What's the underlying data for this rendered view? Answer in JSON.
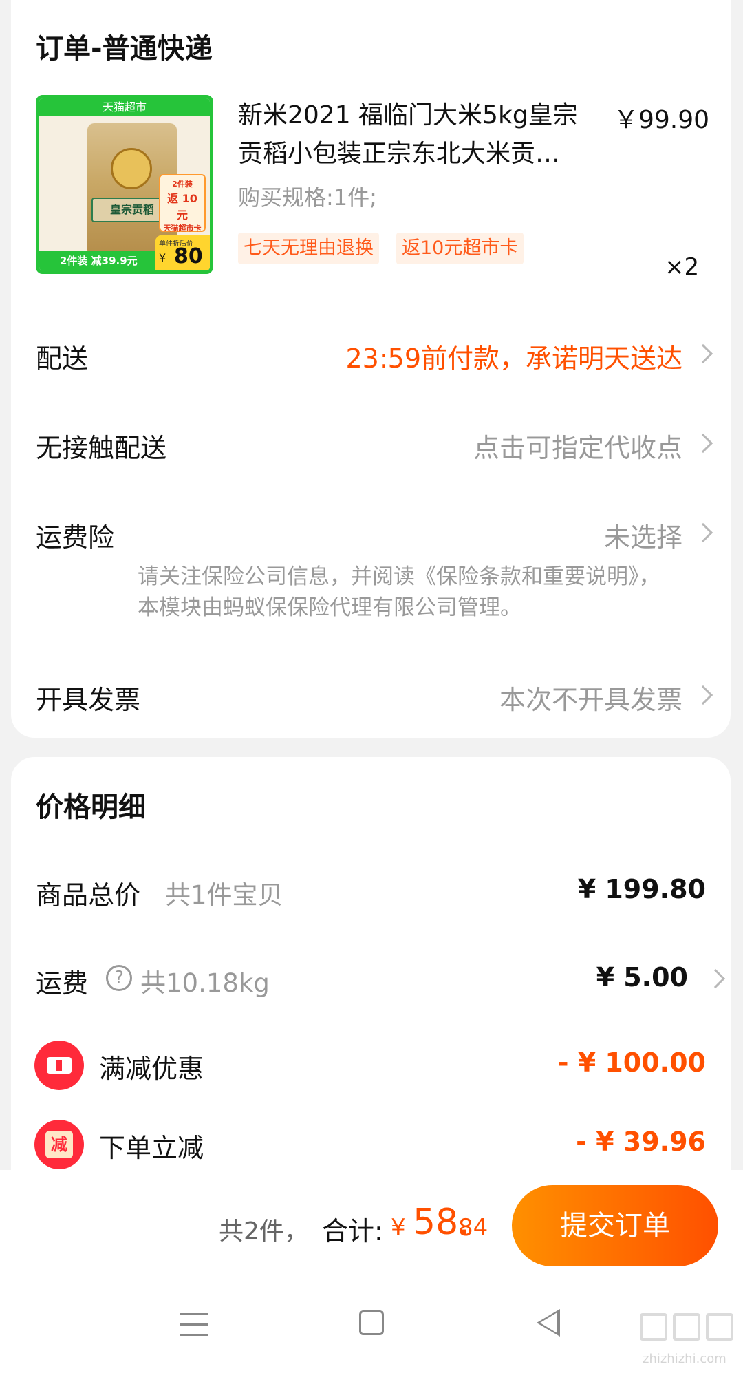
{
  "order": {
    "title": "订单-普通快递",
    "product": {
      "title_line1": "新米2021 福临门大米5kg皇宗",
      "title_line2": "贡稻小包装正宗东北大米贡…",
      "price": "￥99.90",
      "spec": "购买规格:1件;",
      "tags": [
        "七天无理由退换",
        "返10元超市卡"
      ],
      "qty": "×2",
      "image": {
        "top_label": "天猫超市",
        "bag_name": "皇宗贡稻",
        "promo_line1": "2件装",
        "promo_line2": "返 10 元",
        "promo_line3": "天猫超市卡",
        "bottom_label": "2件装 减39.9元",
        "price_caption": "单件折后价",
        "price_yen": "¥",
        "price_value": "80"
      }
    },
    "rows": {
      "delivery": {
        "label": "配送",
        "value": "23:59前付款，承诺明天送达"
      },
      "contactless": {
        "label": "无接触配送",
        "value": "点击可指定代收点"
      },
      "insurance": {
        "label": "运费险",
        "value": "未选择",
        "note": "请关注保险公司信息，并阅读《保险条款和重要说明》，本模块由蚂蚁保保险代理有限公司管理。"
      },
      "invoice": {
        "label": "开具发票",
        "value": "本次不开具发票"
      }
    }
  },
  "price_detail": {
    "title": "价格明细",
    "goods_total": {
      "label": "商品总价",
      "sub": "共1件宝贝",
      "amount": "¥ 199.80"
    },
    "shipping": {
      "label": "运费",
      "sub": "共10.18kg",
      "amount": "¥ 5.00"
    },
    "full_reduction": {
      "label": "满减优惠",
      "amount": "- ¥ 100.00"
    },
    "order_discount": {
      "label": "下单立减",
      "icon_text": "减",
      "amount": "- ¥ 39.96"
    }
  },
  "bottom": {
    "count": "共2件，",
    "total_label": "合计:",
    "yen": "¥",
    "total_int": "58.",
    "total_dec": "84",
    "submit": "提交订单"
  },
  "watermark": "zhizhizhi.com",
  "colors": {
    "accent": "#ff5000",
    "tmall_green": "#26c43a",
    "icon_red": "#ff2a3a"
  }
}
